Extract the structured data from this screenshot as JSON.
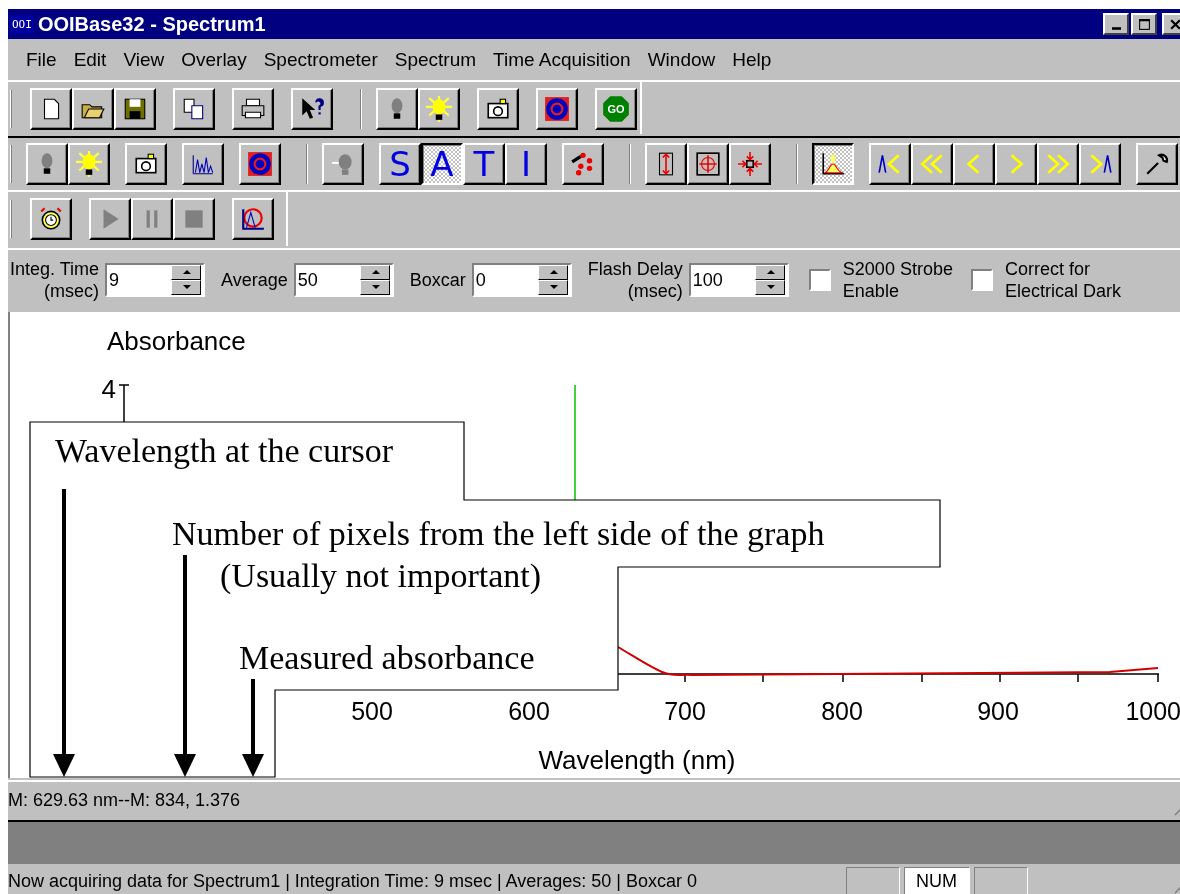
{
  "window": {
    "icon_label": "OOI",
    "title": "OOIBase32 - Spectrum1"
  },
  "menu": [
    {
      "label": "File"
    },
    {
      "label": "Edit"
    },
    {
      "label": "View"
    },
    {
      "label": "Overlay"
    },
    {
      "label": "Spectrometer"
    },
    {
      "label": "Spectrum"
    },
    {
      "label": "Time Acquisition"
    },
    {
      "label": "Window"
    },
    {
      "label": "Help"
    }
  ],
  "toolbar": {
    "go_label": "GO",
    "mode_buttons": [
      {
        "label": "S",
        "selected": false
      },
      {
        "label": "A",
        "selected": true
      },
      {
        "label": "T",
        "selected": false
      },
      {
        "label": "I",
        "selected": false
      }
    ],
    "graph_view": {
      "selected": true
    },
    "transport": {
      "disabled": true
    }
  },
  "acquisition": {
    "fields": [
      {
        "label": "Integ. Time\n(msec)",
        "value": "9"
      },
      {
        "label": "Average",
        "value": "50"
      },
      {
        "label": "Boxcar",
        "value": "0"
      },
      {
        "label": "Flash Delay\n(msec)",
        "value": "100"
      }
    ],
    "checkboxes": [
      {
        "label": "S2000 Strobe\nEnable",
        "checked": false
      },
      {
        "label": "Correct for\nElectrical Dark",
        "checked": false
      }
    ]
  },
  "graph": {
    "ylabel": "Absorbance",
    "ytick": "4",
    "xticks": [
      "500",
      "600",
      "700",
      "800",
      "900",
      "1000"
    ],
    "xlabel": "Wavelength (nm)"
  },
  "annotations": [
    {
      "text": "Wavelength at the cursor"
    },
    {
      "text": "Number of pixels from the left side of the graph"
    },
    {
      "text": "(Usually not important)"
    },
    {
      "text": "Measured absorbance"
    }
  ],
  "cursor_readout": "M: 629.63 nm--M: 834, 1.376",
  "status_bar": {
    "message": "Now acquiring data for Spectrum1 | Integration Time: 9 msec | Averages: 50 | Boxcar 0",
    "num_indicator": "NUM"
  }
}
